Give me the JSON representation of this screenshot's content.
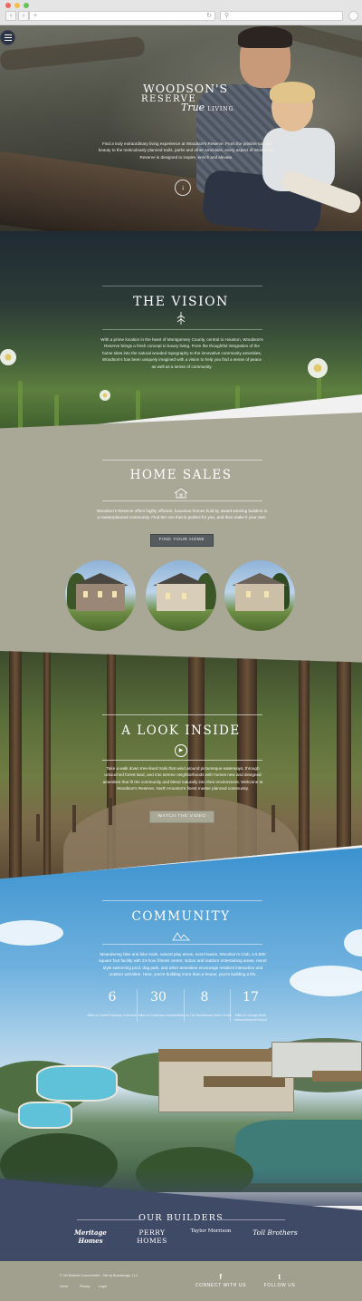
{
  "browser": {
    "back": "‹",
    "forward": "›",
    "url": "+",
    "refresh": "↻",
    "search": "",
    "dots": [
      "#ee6a5f",
      "#f5be4f",
      "#62c655"
    ]
  },
  "hero": {
    "logo_line1": "WOODSON'S",
    "logo_line2": "RESERVE",
    "logo_tagline": "True",
    "logo_tagline2": "LIVING",
    "intro": "Find a truly extraordinary living experience at Woodson's Reserve. From the pristine natural beauty to the meticulously planned trails, parks and other amenities, every aspect of Woodson's Reserve is designed to inspire, enrich and elevate.",
    "scroll_icon": "↓"
  },
  "vision": {
    "title": "THE VISION",
    "body": "With a prime location in the heart of Montgomery County, central to Houston, Woodson's Reserve brings a fresh concept to luxury living. From the thoughtful integration of the home sites into the natural wooded topography to the innovative community amenities, Woodson's has been uniquely imagined with a vision to help you find a sense of peace as well as a sense of community."
  },
  "home_sales": {
    "title": "HOME SALES",
    "body": "Woodson's Reserve offers highly efficient, luxurious homes built by award-winning builders in a masterplanned community. Find the one that is perfect for you, and then make it your own.",
    "button": "FIND YOUR HOME"
  },
  "look_inside": {
    "title": "A LOOK INSIDE",
    "body": "Take a walk down tree-lined trails that wind around picturesque waterways, through untouched forest land, and into serene neighborhoods with homes new and designed amenities that fit the community and blend naturally into their environment. Welcome to Woodson's Reserve, North Houston's finest master planned community.",
    "button": "WATCH THE VIDEO",
    "play_icon": "▶"
  },
  "community": {
    "title": "COMMUNITY",
    "body": "Meandering hike and bike trails, natural play areas, event lawns, Woodson's Club, a 6,800 square foot facility with 24-hour fitness center, indoor and outdoor entertaining areas, resort style swimming pool, dog park, and other amenities encourage resident interaction and outdoor activities. Here, you're building more than a house; you're building a life.",
    "stats": [
      {
        "num": "6",
        "label": "Miles to Grand Parkway Commute"
      },
      {
        "num": "30",
        "label": "Miles to Downtown Houston"
      },
      {
        "num": "8",
        "label": "Miles to The Woodlands Town Center"
      },
      {
        "num": "17",
        "label": "Miles to George Bush Intercontinental Airport"
      }
    ]
  },
  "builders": {
    "title": "OUR BUILDERS",
    "logos": [
      "Meritage Homes",
      "PERRY HOMES",
      "Taylor Morrison",
      "Toll Brothers"
    ]
  },
  "footer": {
    "copyright": "© Toll Brothers Communities · Site by Brandimage, LLC",
    "links": [
      "Home",
      "Privacy",
      "Legal"
    ],
    "connect_icon": "f",
    "connect": "CONNECT WITH US",
    "follow_icon": "t",
    "follow": "FOLLOW US"
  }
}
